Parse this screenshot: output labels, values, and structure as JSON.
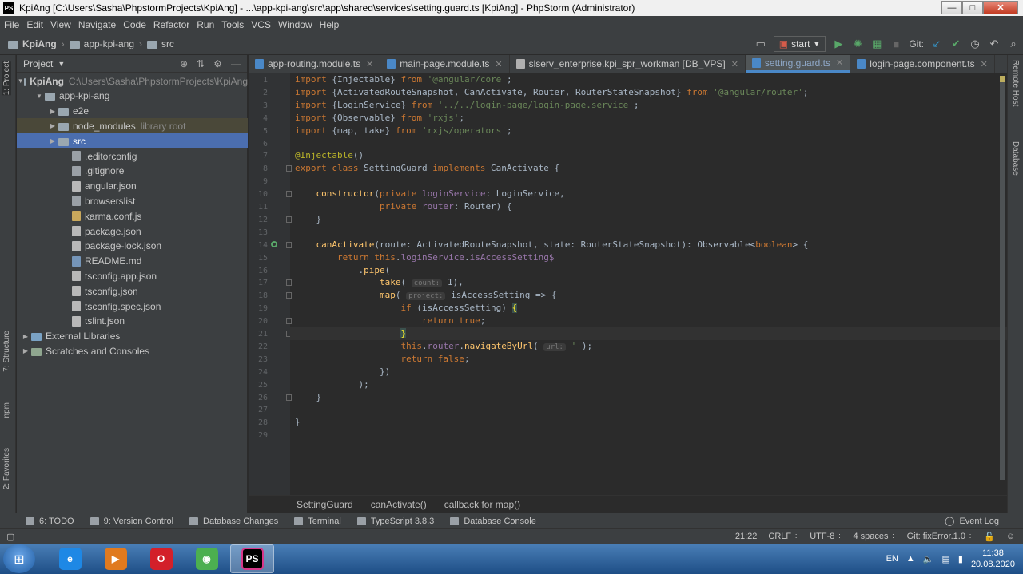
{
  "window": {
    "title": "KpiAng [C:\\Users\\Sasha\\PhpstormProjects\\KpiAng] - ...\\app-kpi-ang\\src\\app\\shared\\services\\setting.guard.ts [KpiAng] - PhpStorm (Administrator)",
    "icon_text": "PS",
    "minimize": "—",
    "maximize": "□",
    "close": "✕"
  },
  "menu": [
    "File",
    "Edit",
    "View",
    "Navigate",
    "Code",
    "Refactor",
    "Run",
    "Tools",
    "VCS",
    "Window",
    "Help"
  ],
  "breadcrumb": [
    "KpiAng",
    "app-kpi-ang",
    "src"
  ],
  "toolbar": {
    "run_config": "start",
    "git_label": "Git:"
  },
  "project_panel": {
    "title": "Project",
    "tree": [
      {
        "label": "KpiAng",
        "hint": "C:\\Users\\Sasha\\PhpstormProjects\\KpiAng",
        "level": 0,
        "expanded": true,
        "type": "folder"
      },
      {
        "label": "app-kpi-ang",
        "level": 1,
        "expanded": true,
        "type": "folder"
      },
      {
        "label": "e2e",
        "level": 2,
        "expanded": false,
        "type": "folder"
      },
      {
        "label": "node_modules",
        "hint": "library root",
        "level": 2,
        "expanded": false,
        "type": "folder"
      },
      {
        "label": "src",
        "level": 2,
        "expanded": false,
        "type": "folder"
      },
      {
        "label": ".editorconfig",
        "level": 3,
        "type": "cfg"
      },
      {
        "label": ".gitignore",
        "level": 3,
        "type": "cfg"
      },
      {
        "label": "angular.json",
        "level": 3,
        "type": "json"
      },
      {
        "label": "browserslist",
        "level": 3,
        "type": "cfg"
      },
      {
        "label": "karma.conf.js",
        "level": 3,
        "type": "js"
      },
      {
        "label": "package.json",
        "level": 3,
        "type": "json"
      },
      {
        "label": "package-lock.json",
        "level": 3,
        "type": "json"
      },
      {
        "label": "README.md",
        "level": 3,
        "type": "md"
      },
      {
        "label": "tsconfig.app.json",
        "level": 3,
        "type": "json"
      },
      {
        "label": "tsconfig.json",
        "level": 3,
        "type": "json"
      },
      {
        "label": "tsconfig.spec.json",
        "level": 3,
        "type": "json"
      },
      {
        "label": "tslint.json",
        "level": 3,
        "type": "json"
      },
      {
        "label": "External Libraries",
        "level": 0,
        "expanded": false,
        "type": "lib"
      },
      {
        "label": "Scratches and Consoles",
        "level": 0,
        "expanded": false,
        "type": "scratch"
      }
    ]
  },
  "left_stripe": [
    "1: Project",
    "7: Structure",
    "npm",
    "2: Favorites"
  ],
  "right_stripe": [
    "Remote Host",
    "Database"
  ],
  "tabs": [
    {
      "label": "app-routing.module.ts",
      "type": "ts"
    },
    {
      "label": "main-page.module.ts",
      "type": "ts"
    },
    {
      "label": "slserv_enterprise.kpi_spr_workman [DB_VPS]",
      "type": "db"
    },
    {
      "label": "setting.guard.ts",
      "type": "ts",
      "active": true
    },
    {
      "label": "login-page.component.ts",
      "type": "ts"
    }
  ],
  "code_lines": [
    "1",
    "2",
    "3",
    "4",
    "5",
    "6",
    "7",
    "8",
    "9",
    "10",
    "11",
    "12",
    "13",
    "14",
    "15",
    "16",
    "17",
    "18",
    "19",
    "20",
    "21",
    "22",
    "23",
    "24",
    "25",
    "26",
    "27",
    "28",
    "29"
  ],
  "editor_breadcrumb": [
    "SettingGuard",
    "canActivate()",
    "callback for map()"
  ],
  "bottom_tools": [
    "6: TODO",
    "9: Version Control",
    "Database Changes",
    "Terminal",
    "TypeScript 3.8.3",
    "Database Console",
    "Event Log"
  ],
  "status": {
    "position": "21:22",
    "line_sep": "CRLF ÷",
    "encoding": "UTF-8 ÷",
    "indent": "4 spaces ÷",
    "branch": "Git: fixError.1.0 ÷"
  },
  "taskbar": {
    "lang": "EN",
    "time": "11:38",
    "date": "20.08.2020",
    "apps": [
      {
        "name": "ie",
        "glyph": "e",
        "color": "#1e88e5"
      },
      {
        "name": "media-player",
        "glyph": "▶",
        "color": "#e07a1f"
      },
      {
        "name": "opera",
        "glyph": "O",
        "color": "#d3202a"
      },
      {
        "name": "chrome",
        "glyph": "◉",
        "color": "#4caf50"
      },
      {
        "name": "phpstorm",
        "glyph": "PS",
        "color": "#000000",
        "active": true
      }
    ]
  }
}
